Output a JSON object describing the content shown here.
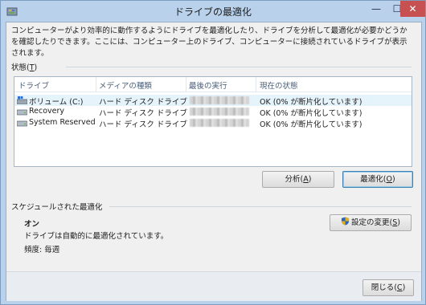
{
  "window": {
    "title": "ドライブの最適化",
    "controls": {
      "minimize": "—",
      "maximize": "☐",
      "close": "✕"
    }
  },
  "description": "コンピューターがより効率的に動作するようにドライブを最適化したり、ドライブを分析して最適化が必要かどうかを確認したりできます。ここには、コンピューター上のドライブ、コンピューターに接続されているドライブが表示されます。",
  "status_section": {
    "label": "状態(",
    "accel": "T",
    "suffix": ")"
  },
  "drive_list": {
    "columns": [
      "ドライブ",
      "メディアの種類",
      "最後の実行",
      "現在の状態"
    ],
    "rows": [
      {
        "drive": "ボリューム (C:)",
        "media": "ハード ディスク ドライブ",
        "last_run": "",
        "status": "OK (0% が断片化しています)",
        "icon": "windows-drive-icon",
        "selected": true
      },
      {
        "drive": "Recovery",
        "media": "ハード ディスク ドライブ",
        "last_run": "",
        "status": "OK (0% が断片化しています)",
        "icon": "hard-drive-icon",
        "selected": false
      },
      {
        "drive": "System Reserved",
        "media": "ハード ディスク ドライブ",
        "last_run": "",
        "status": "OK (0% が断片化しています)",
        "icon": "hard-drive-icon",
        "selected": false
      }
    ]
  },
  "buttons": {
    "analyze": {
      "label": "分析(",
      "accel": "A",
      "suffix": ")"
    },
    "optimize": {
      "label": "最適化(",
      "accel": "O",
      "suffix": ")"
    },
    "change_settings": {
      "label": "設定の変更(",
      "accel": "S",
      "suffix": ")"
    },
    "close": {
      "label": "閉じる(",
      "accel": "C",
      "suffix": ")"
    }
  },
  "schedule": {
    "label": "スケジュールされた最適化",
    "status": "オン",
    "description": "ドライブは自動的に最適化されています。",
    "frequency": "頻度: 毎週"
  },
  "colors": {
    "accent": "#3c7fb1",
    "titlebar": "#b9d1ea",
    "close": "#c75050",
    "selection": "#e5f3fb"
  }
}
